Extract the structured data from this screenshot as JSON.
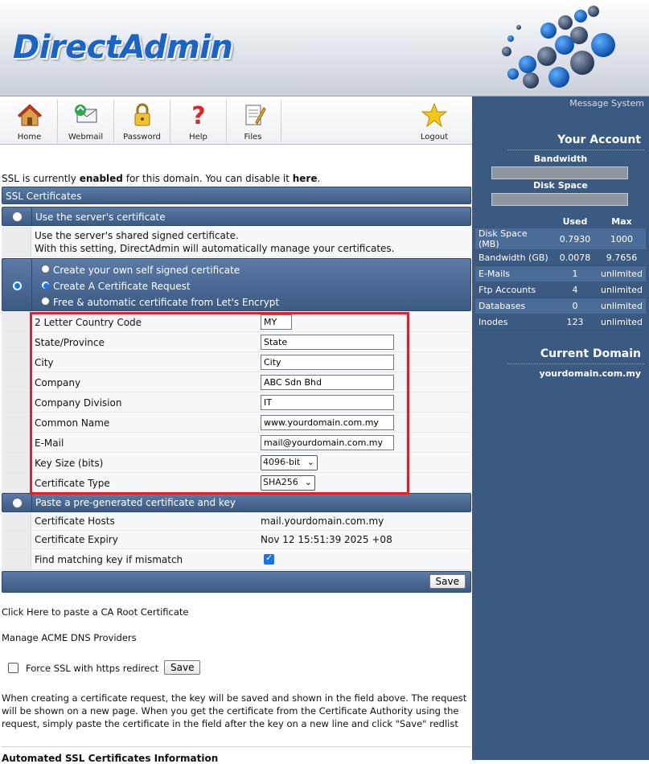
{
  "header": {
    "logo_text": "DirectAdmin"
  },
  "nav": [
    {
      "label": "Home",
      "icon": "home-icon"
    },
    {
      "label": "Webmail",
      "icon": "webmail-icon"
    },
    {
      "label": "Password",
      "icon": "lock-icon"
    },
    {
      "label": "Help",
      "icon": "help-icon"
    },
    {
      "label": "Files",
      "icon": "files-icon"
    },
    {
      "label": "Logout",
      "icon": "star-icon"
    }
  ],
  "sidebar": {
    "message_system": "Message System",
    "your_account": "Your Account",
    "bandwidth_label": "Bandwidth",
    "disk_space_label": "Disk Space",
    "col_used": "Used",
    "col_max": "Max",
    "stats": [
      {
        "name": "Disk Space (MB)",
        "used": "0.7930",
        "max": "1000"
      },
      {
        "name": "Bandwidth (GB)",
        "used": "0.0078",
        "max": "9.7656"
      },
      {
        "name": "E-Mails",
        "used": "1",
        "max": "unlimited"
      },
      {
        "name": "Ftp Accounts",
        "used": "4",
        "max": "unlimited"
      },
      {
        "name": "Databases",
        "used": "0",
        "max": "unlimited"
      },
      {
        "name": "Inodes",
        "used": "123",
        "max": "unlimited"
      }
    ],
    "current_domain_title": "Current Domain",
    "current_domain": "yourdomain.com.my"
  },
  "main": {
    "ssl_status": {
      "pre": "SSL is currently ",
      "state": "enabled",
      "mid": " for this domain. You can disable it ",
      "link": "here",
      "post": "."
    },
    "section_title": "SSL Certificates",
    "option_server": "Use the server's certificate",
    "server_desc_1": "Use the server's shared signed certificate.",
    "server_desc_2": "With this setting, DirectAdmin will automatically manage your certificates.",
    "option_self_signed": "Create your own self signed certificate",
    "option_request": "Create A Certificate Request",
    "option_letsencrypt": "Free & automatic certificate from Let's Encrypt",
    "form": {
      "country_label": "2 Letter Country Code",
      "country_value": "MY",
      "state_label": "State/Province",
      "state_value": "State",
      "city_label": "City",
      "city_value": "City",
      "company_label": "Company",
      "company_value": "ABC Sdn Bhd",
      "division_label": "Company Division",
      "division_value": "IT",
      "common_name_label": "Common Name",
      "common_name_value": "www.yourdomain.com.my",
      "email_label": "E-Mail",
      "email_value": "mail@yourdomain.com.my",
      "key_size_label": "Key Size (bits)",
      "key_size_value": "4096-bit",
      "cert_type_label": "Certificate Type",
      "cert_type_value": "SHA256"
    },
    "option_paste": "Paste a pre-generated certificate and key",
    "hosts_label": "Certificate Hosts",
    "hosts_value": "mail.yourdomain.com.my",
    "expiry_label": "Certificate Expiry",
    "expiry_value": "Nov 12 15:51:39 2025 +08",
    "match_label": "Find matching key if mismatch",
    "save_label": "Save",
    "ca_root_link": "Click Here to paste a CA Root Certificate",
    "acme_link": "Manage ACME DNS Providers",
    "force_ssl_label": "Force SSL with https redirect",
    "force_save_label": "Save",
    "help_text": "When creating a certificate request, the key will be saved and shown in the field above. The request will be shown on a new page. When you get the certificate from the Certificate Authority using the request, simply paste the certificate in the field after the key on a new line and click \"Save\" redlist",
    "auto_heading": "Automated SSL Certificates Information"
  },
  "colors": {
    "accent": "#3a5a82",
    "logo": "#1a63c7",
    "highlight": "#e0202a"
  }
}
